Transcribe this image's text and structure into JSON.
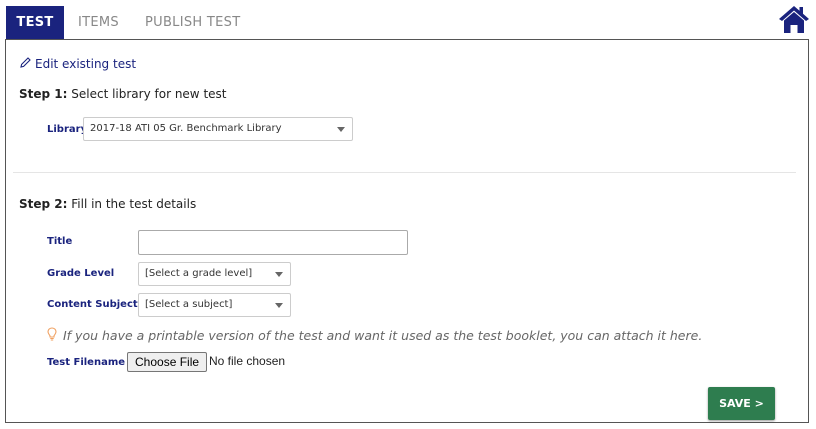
{
  "tabs": [
    {
      "label": "TEST",
      "active": true
    },
    {
      "label": "ITEMS",
      "active": false
    },
    {
      "label": "PUBLISH TEST",
      "active": false
    }
  ],
  "icons": {
    "home": "home-icon",
    "edit": "pencil-icon",
    "tip": "lightbulb-icon"
  },
  "colors": {
    "accent": "#1a237e",
    "save": "#2e7d4f",
    "tip": "#f0a060"
  },
  "edit_link": "Edit existing test",
  "step1": {
    "bold": "Step 1:",
    "text": " Select library for new test"
  },
  "library": {
    "label": "Library",
    "value": "2017-18 ATI 05 Gr. Benchmark Library"
  },
  "step2": {
    "bold": "Step 2:",
    "text": " Fill in the test details"
  },
  "fields": {
    "title_label": "Title",
    "title_value": "",
    "grade_label": "Grade Level",
    "grade_value": "[Select a grade level]",
    "subject_label": "Content Subject",
    "subject_value": "[Select a subject]"
  },
  "note": "If you have a printable version of the test and want it used as the test booklet, you can attach it here.",
  "file": {
    "label": "Test Filename",
    "button": "Choose File",
    "status": "No file chosen"
  },
  "save_button": "SAVE >"
}
